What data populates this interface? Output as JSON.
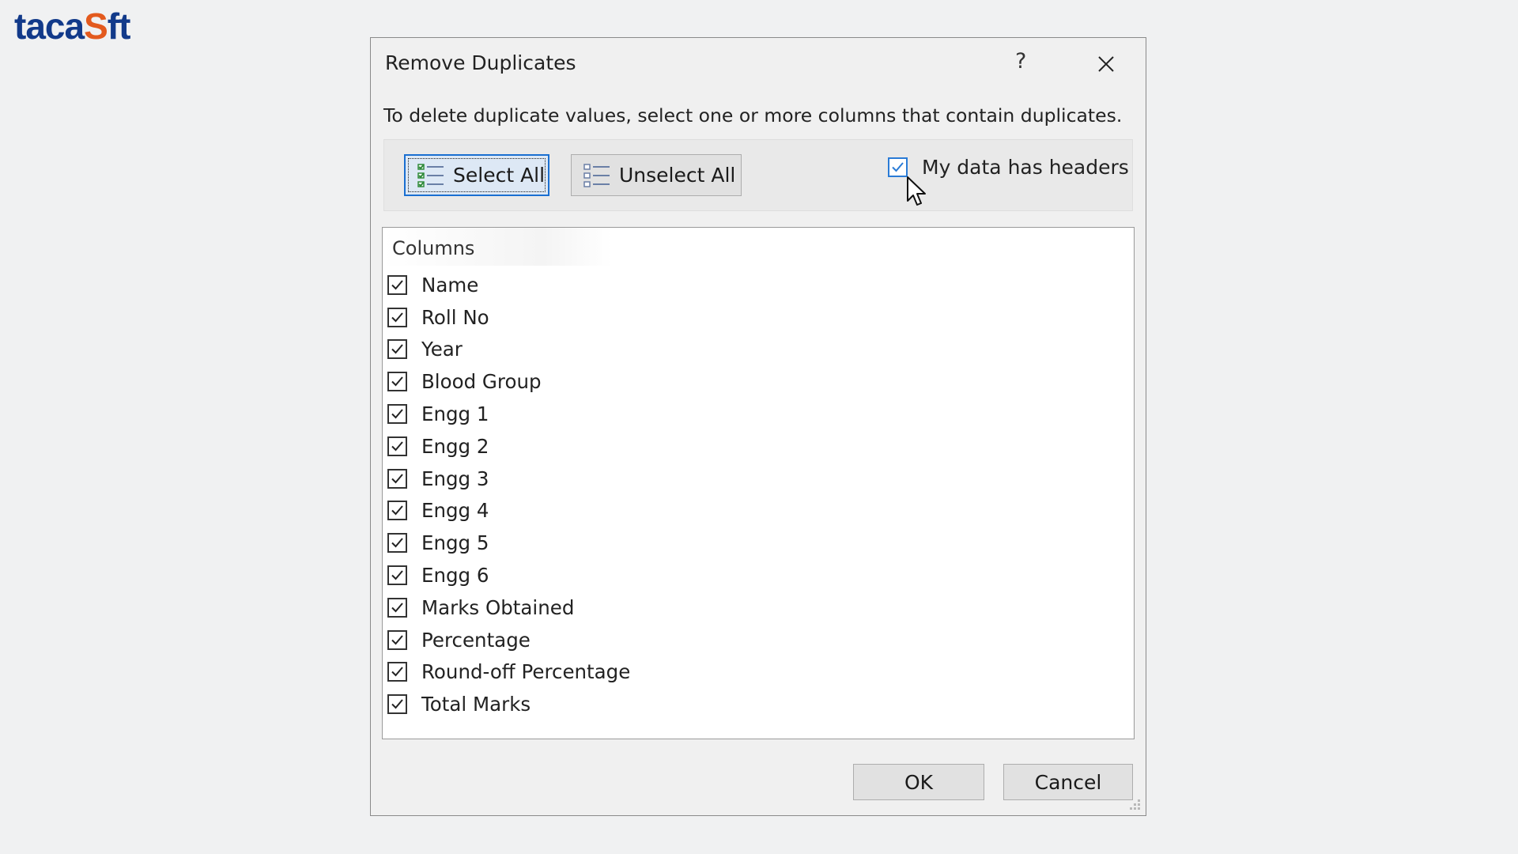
{
  "brand": {
    "logo_left": "taca",
    "logo_o": "S",
    "logo_right": "ft"
  },
  "dialog": {
    "title": "Remove Duplicates",
    "help_label": "?",
    "instruction": "To delete duplicate values, select one or more columns that contain duplicates.",
    "select_all_label": "Select All",
    "unselect_all_label": "Unselect All",
    "headers_checkbox": {
      "label": "My data has headers",
      "checked": true
    },
    "columns_header": "Columns",
    "columns": [
      {
        "label": "Name",
        "checked": true
      },
      {
        "label": "Roll No",
        "checked": true
      },
      {
        "label": "Year",
        "checked": true
      },
      {
        "label": "Blood Group",
        "checked": true
      },
      {
        "label": "Engg 1",
        "checked": true
      },
      {
        "label": "Engg 2",
        "checked": true
      },
      {
        "label": "Engg 3",
        "checked": true
      },
      {
        "label": "Engg 4",
        "checked": true
      },
      {
        "label": "Engg 5",
        "checked": true
      },
      {
        "label": "Engg 6",
        "checked": true
      },
      {
        "label": "Marks Obtained",
        "checked": true
      },
      {
        "label": "Percentage",
        "checked": true
      },
      {
        "label": "Round-off Percentage",
        "checked": true
      },
      {
        "label": "Total Marks",
        "checked": true
      }
    ],
    "ok_label": "OK",
    "cancel_label": "Cancel"
  },
  "colors": {
    "logo_blue": "#123a8a",
    "logo_orange": "#e35a1e",
    "focus_blue": "#1a6fd1"
  },
  "icons": [
    "select-all-icon",
    "unselect-all-icon",
    "close-icon",
    "mouse-cursor-icon",
    "resize-grip-icon"
  ]
}
